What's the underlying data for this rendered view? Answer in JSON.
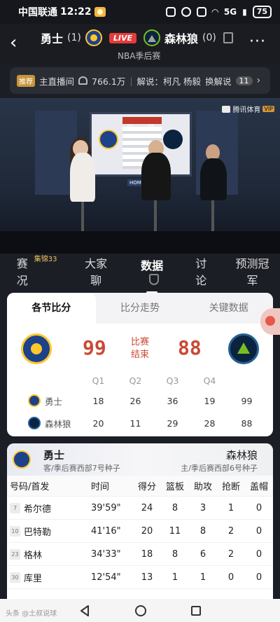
{
  "status_bar": {
    "carrier": "中国联通",
    "time": "12:22",
    "network": "5G",
    "battery": "75"
  },
  "header": {
    "home_team": "勇士",
    "home_series": "(1)",
    "live_label": "LIVE",
    "away_team": "森林狼",
    "away_series": "(0)",
    "subtitle": "NBA季后赛"
  },
  "commentary": {
    "tag": "推荐",
    "channel": "主直播间",
    "viewers": "766.1万",
    "commentators": "解说：柯凡 杨毅",
    "switch_label": "换解说",
    "count": "11"
  },
  "video": {
    "watermark": "腾讯体育",
    "watermark_badge": "VIP",
    "screen_home_score": "99",
    "screen_away_score": "88",
    "desk_label": "HOME"
  },
  "tabs": [
    {
      "label": "赛况",
      "badge": "集锦33"
    },
    {
      "label": "大家聊",
      "badge": ""
    },
    {
      "label": "数据",
      "badge": ""
    },
    {
      "label": "讨论",
      "badge": ""
    },
    {
      "label": "预测冠军",
      "badge": ""
    }
  ],
  "scoreboard": {
    "tabs": [
      "各节比分",
      "比分走势",
      "关键数据"
    ],
    "home_score": "99",
    "away_score": "88",
    "status_line1": "比赛",
    "status_line2": "结束",
    "quarters": [
      "Q1",
      "Q2",
      "Q3",
      "Q4"
    ],
    "rows": [
      {
        "team": "勇士",
        "q": [
          "18",
          "26",
          "36",
          "19"
        ],
        "total": "99"
      },
      {
        "team": "森林狼",
        "q": [
          "20",
          "11",
          "29",
          "28"
        ],
        "total": "88"
      }
    ]
  },
  "player_stats": {
    "home_team": "勇士",
    "home_sub": "客/季后赛西部7号种子",
    "away_team": "森林狼",
    "away_sub": "主/季后赛西部6号种子",
    "columns": [
      "号码/首发",
      "时间",
      "得分",
      "篮板",
      "助攻",
      "抢断",
      "盖帽"
    ],
    "players": [
      {
        "num": "7",
        "name": "希尔德",
        "time": "39'59\"",
        "pts": "24",
        "reb": "8",
        "ast": "3",
        "stl": "1",
        "blk": "0"
      },
      {
        "num": "10",
        "name": "巴特勒",
        "time": "41'16\"",
        "pts": "20",
        "reb": "11",
        "ast": "8",
        "stl": "2",
        "blk": "0"
      },
      {
        "num": "23",
        "name": "格林",
        "time": "34'33\"",
        "pts": "18",
        "reb": "8",
        "ast": "6",
        "stl": "2",
        "blk": "0"
      },
      {
        "num": "30",
        "name": "库里",
        "time": "12'54\"",
        "pts": "13",
        "reb": "1",
        "ast": "1",
        "stl": "0",
        "blk": "0"
      }
    ]
  },
  "nav_watermark": "头条 @土叔说球",
  "colors": {
    "accent_red": "#c94a36",
    "live_red": "#e33b3b",
    "warriors_blue": "#1d428a",
    "warriors_gold": "#ffc72c",
    "wolves_navy": "#0c2340"
  }
}
